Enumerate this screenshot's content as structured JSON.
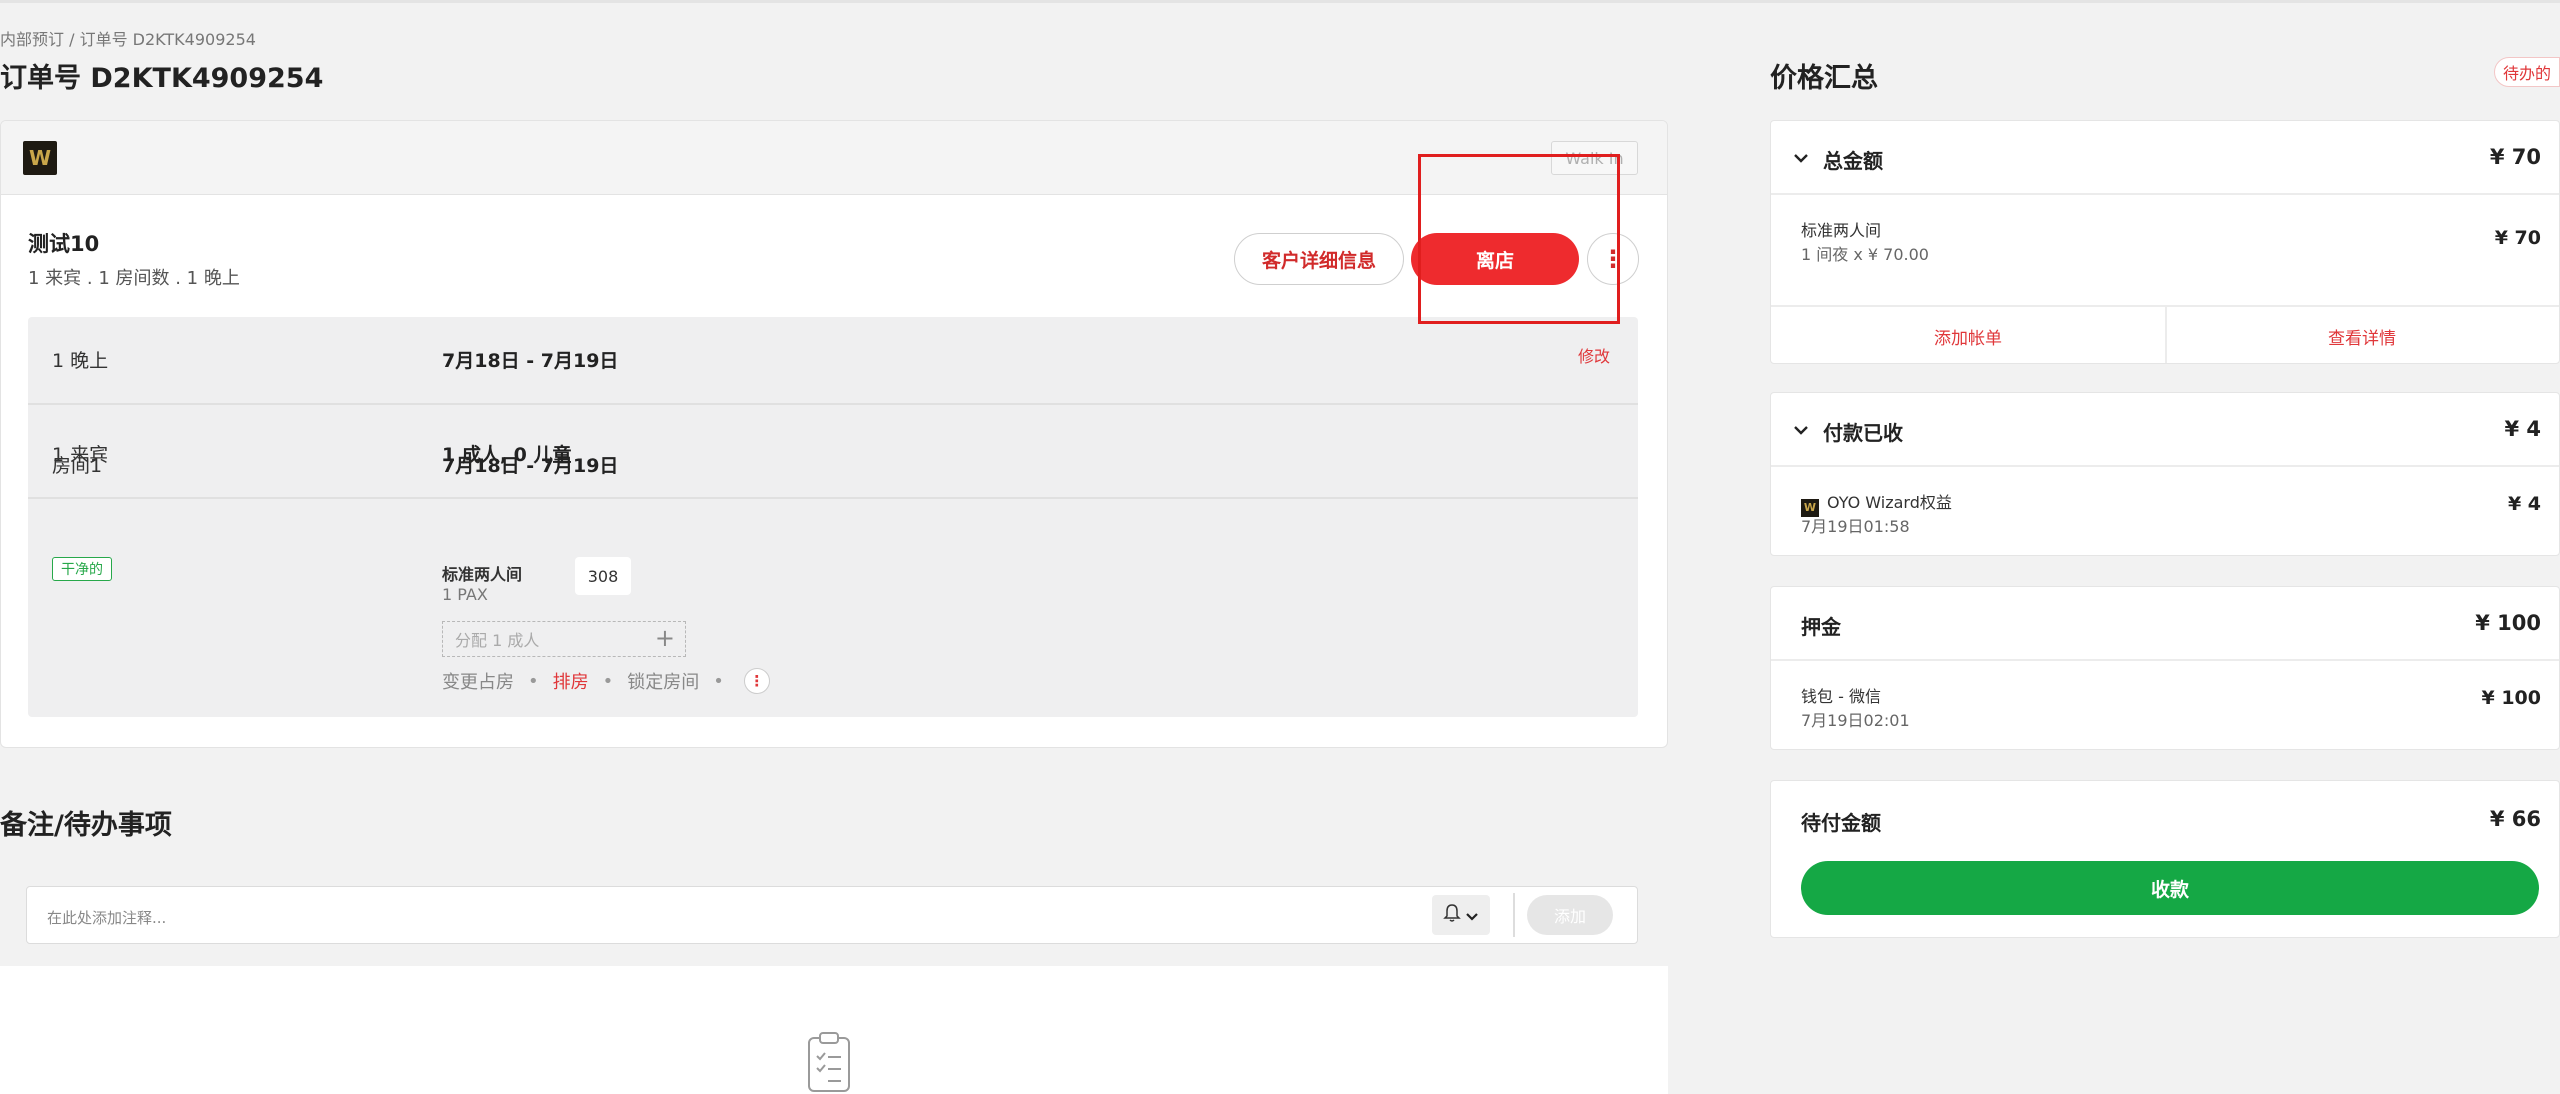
{
  "breadcrumb": "内部预订 / 订单号 D2KTK4909254",
  "page_title": "订单号 D2KTK4909254",
  "order": {
    "brand_logo_letter": "W",
    "walk_in_label": "Walk In",
    "guest_name": "测试10",
    "guest_summary": "1 来宾 . 1 房间数 . 1 晚上",
    "customer_details_button": "客户详细信息",
    "checkout_button": "离店",
    "more_button": "⋮",
    "nights_label": "1 晚上",
    "nights_dates": "7月18日 - 7月19日",
    "edit_link": "修改",
    "guests_label": "1 来宾",
    "guests_value": "1 成人, 0 儿童",
    "room": {
      "label": "房间1",
      "status_badge": "干净的",
      "dates": "7月18日 - 7月19日",
      "type": "标准两人间",
      "pax": "1 PAX",
      "number": "308",
      "assign_placeholder": "分配 1 成人",
      "assign_plus": "+",
      "action_change": "变更占房",
      "action_arrange": "排房",
      "action_lock": "锁定房间",
      "action_more": "⋮"
    }
  },
  "notes": {
    "title": "备注/待办事项",
    "placeholder": "在此处添加注释...",
    "bell_icon": "🔔",
    "bell_chevron": "⌄",
    "add_button": "添加"
  },
  "price_summary": {
    "title": "价格汇总",
    "pending_badge": "待办的",
    "total": {
      "chevron": "⌄",
      "label": "总金额",
      "amount": "¥ 70",
      "item_title": "标准两人间",
      "item_sub": "1 间夜 x ¥ 70.00",
      "item_amount": "¥ 70",
      "add_bill": "添加帐单",
      "view_details": "查看详情"
    },
    "paid": {
      "chevron": "⌄",
      "label": "付款已收",
      "amount": "¥ 4",
      "item_logo": "W",
      "item_title": "OYO Wizard权益",
      "item_sub": "7月19日01:58",
      "item_amount": "¥ 4"
    },
    "deposit": {
      "label": "押金",
      "amount": "¥ 100",
      "item_title": "钱包 - 微信",
      "item_sub": "7月19日02:01",
      "item_amount": "¥ 100"
    },
    "due": {
      "label": "待付金额",
      "amount": "¥ 66",
      "collect_button": "收款"
    }
  },
  "colors": {
    "accent_red": "#ee2b2e",
    "success_green": "#15a845",
    "brand_gold": "#c9a64a"
  }
}
